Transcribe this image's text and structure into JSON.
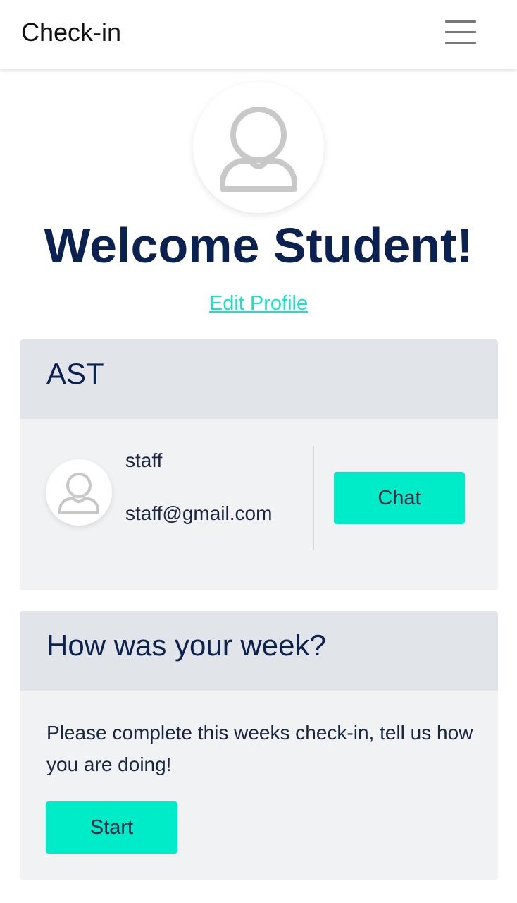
{
  "header": {
    "title": "Check-in",
    "menu_icon": "hamburger-menu-icon"
  },
  "profile": {
    "avatar_icon": "user-avatar-icon",
    "welcome": "Welcome Student!",
    "edit_link": "Edit Profile"
  },
  "ast_card": {
    "title": "AST",
    "staff": {
      "avatar_icon": "user-avatar-icon",
      "name": "staff",
      "email": "staff@gmail.com"
    },
    "chat_label": "Chat"
  },
  "week_card": {
    "title": "How was your week?",
    "text": "Please complete this weeks check-in, tell us how you are doing!",
    "start_label": "Start"
  },
  "colors": {
    "accent": "#00ecc8",
    "link": "#17e3c6",
    "heading": "#0b2150",
    "card_header_bg": "#e1e4e9",
    "card_body_bg": "#f1f2f4"
  }
}
